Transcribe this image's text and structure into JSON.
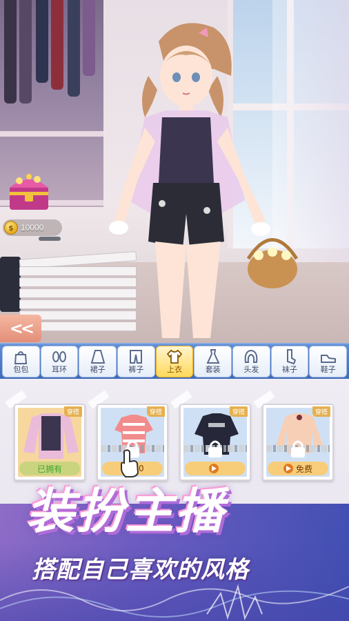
{
  "hud": {
    "coins": "10000",
    "back_label": "<<"
  },
  "categories": [
    {
      "label": "包包",
      "icon": "bag-icon",
      "active": false
    },
    {
      "label": "耳环",
      "icon": "earring-icon",
      "active": false
    },
    {
      "label": "裙子",
      "icon": "skirt-icon",
      "active": false
    },
    {
      "label": "裤子",
      "icon": "pants-icon",
      "active": false
    },
    {
      "label": "上衣",
      "icon": "top-icon",
      "active": true
    },
    {
      "label": "套装",
      "icon": "dress-icon",
      "active": false
    },
    {
      "label": "头发",
      "icon": "hair-icon",
      "active": false
    },
    {
      "label": "袜子",
      "icon": "sock-icon",
      "active": false
    },
    {
      "label": "鞋子",
      "icon": "shoe-icon",
      "active": false
    }
  ],
  "items": [
    {
      "tag": "穿搭",
      "status": "已拥有",
      "locked": false
    },
    {
      "tag": "穿搭",
      "status": "00",
      "locked": true
    },
    {
      "tag": "穿搭",
      "status": "",
      "locked": true
    },
    {
      "tag": "穿搭",
      "status": "免费",
      "locked": true
    }
  ],
  "promo": {
    "title": "装扮主播",
    "subtitle": "搭配自己喜欢的风格"
  },
  "colors": {
    "category_bar": "#4f7cc8",
    "active_category": "#ffd95a",
    "promo_purple": "#6c5cc1"
  }
}
